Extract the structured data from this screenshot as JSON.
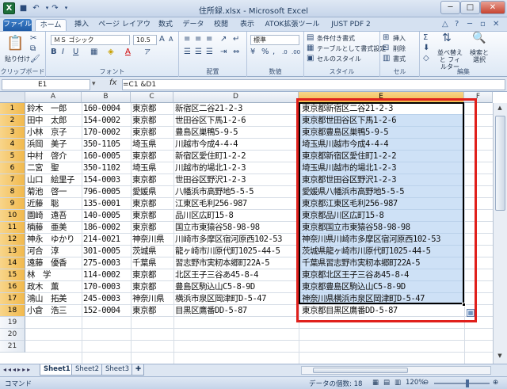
{
  "window": {
    "title": "住所録.xlsx - Microsoft Excel",
    "app_icon_label": "X"
  },
  "ribbon_tabs": [
    "ファイル",
    "ホーム",
    "挿入",
    "ページ レイアウト",
    "数式",
    "データ",
    "校閲",
    "表示",
    "ATOK拡張ツール",
    "JUST PDF 2"
  ],
  "ribbon": {
    "clipboard": {
      "group_label": "クリップボード",
      "paste_label": "貼り付け"
    },
    "font": {
      "group_label": "フォント",
      "font_name": "ＭＳ ゴシック",
      "font_size": "10.5"
    },
    "alignment": {
      "group_label": "配置"
    },
    "number": {
      "group_label": "数値",
      "format": "標準"
    },
    "styles": {
      "group_label": "スタイル",
      "conditional": "条件付き書式",
      "table": "テーブルとして書式設定",
      "cell_style": "セルのスタイル"
    },
    "cells": {
      "group_label": "セル",
      "insert": "挿入",
      "delete": "削除",
      "format": "書式"
    },
    "editing": {
      "group_label": "編集",
      "sort": "並べ替えと フィルター",
      "find": "検索と 選択"
    }
  },
  "formula_bar": {
    "name_box": "E1",
    "fx": "fx",
    "formula": "=C1 &D1"
  },
  "columns": [
    "A",
    "B",
    "C",
    "D",
    "E",
    "F"
  ],
  "rows": [
    {
      "n": "1",
      "a": "鈴木　一郎",
      "b": "160-0004",
      "c": "東京都",
      "d": "新宿区二谷21-2-3",
      "e": "東京都新宿区二谷21-2-3"
    },
    {
      "n": "2",
      "a": "田中　太郎",
      "b": "154-0002",
      "c": "東京都",
      "d": "世田谷区下馬1-2-6",
      "e": "東京都世田谷区下馬1-2-6"
    },
    {
      "n": "3",
      "a": "小林　京子",
      "b": "170-0002",
      "c": "東京都",
      "d": "豊島区巣鴨5-9-5",
      "e": "東京都豊島区巣鴨5-9-5"
    },
    {
      "n": "4",
      "a": "浜岡　美子",
      "b": "350-1105",
      "c": "埼玉県",
      "d": "川越市今成4-4-4",
      "e": "埼玉県川越市今成4-4-4"
    },
    {
      "n": "5",
      "a": "中村　啓介",
      "b": "160-0005",
      "c": "東京都",
      "d": "新宿区愛住町1-2-2",
      "e": "東京都新宿区愛住町1-2-2"
    },
    {
      "n": "6",
      "a": "二宮　聖",
      "b": "350-1102",
      "c": "埼玉県",
      "d": "川越市的場北1-2-3",
      "e": "埼玉県川越市的場北1-2-3"
    },
    {
      "n": "7",
      "a": "山口　絵里子",
      "b": "154-0003",
      "c": "東京都",
      "d": "世田谷区野沢1-2-3",
      "e": "東京都世田谷区野沢1-2-3"
    },
    {
      "n": "8",
      "a": "菊池　啓一",
      "b": "796-0005",
      "c": "愛媛県",
      "d": "八幡浜市高野地5-5-5",
      "e": "愛媛県八幡浜市高野地5-5-5"
    },
    {
      "n": "9",
      "a": "近藤　聡",
      "b": "135-0001",
      "c": "東京都",
      "d": "江東区毛利256-987",
      "e": "東京都江東区毛利256-987"
    },
    {
      "n": "10",
      "a": "園崎　遠吾",
      "b": "140-0005",
      "c": "東京都",
      "d": "品川区広町15-8",
      "e": "東京都品川区広町15-8"
    },
    {
      "n": "11",
      "a": "楠藤　亜美",
      "b": "186-0002",
      "c": "東京都",
      "d": "国立市東猿谷58-98-98",
      "e": "東京都国立市東猿谷58-98-98"
    },
    {
      "n": "12",
      "a": "神永　ゆかり",
      "b": "214-0021",
      "c": "神奈川県",
      "d": "川崎市多摩区宿河原西102-53",
      "e": "神奈川県川崎市多摩区宿河原西102-53"
    },
    {
      "n": "13",
      "a": "河合　淳",
      "b": "301-0005",
      "c": "茨城県",
      "d": "龍ヶ崎市川原代町1025-44-5",
      "e": "茨城県龍ヶ崎市川原代町1025-44-5"
    },
    {
      "n": "14",
      "a": "遠藤　優香",
      "b": "275-0003",
      "c": "千葉県",
      "d": "習志野市実籾本郷町22A-5",
      "e": "千葉県習志野市実籾本郷町22A-5"
    },
    {
      "n": "15",
      "a": "林　学",
      "b": "114-0002",
      "c": "東京都",
      "d": "北区王子三谷あ45-8-4",
      "e": "東京都北区王子三谷あ45-8-4"
    },
    {
      "n": "16",
      "a": "政木　薫",
      "b": "170-0003",
      "c": "東京都",
      "d": "豊島区駒込山C5-8-9D",
      "e": "東京都豊島区駒込山C5-8-9D"
    },
    {
      "n": "17",
      "a": "鴻山　拓美",
      "b": "245-0003",
      "c": "神奈川県",
      "d": "横浜市泉区岡津町D-5-47",
      "e": "神奈川県横浜市泉区岡津町D-5-47"
    },
    {
      "n": "18",
      "a": "小倉　浩三",
      "b": "152-0004",
      "c": "東京都",
      "d": "目黒区鷹番DD-5-87",
      "e": "東京都目黒区鷹番DD-5-87"
    },
    {
      "n": "19",
      "a": "",
      "b": "",
      "c": "",
      "d": "",
      "e": ""
    },
    {
      "n": "20",
      "a": "",
      "b": "",
      "c": "",
      "d": "",
      "e": ""
    },
    {
      "n": "21",
      "a": "",
      "b": "",
      "c": "",
      "d": "",
      "e": ""
    }
  ],
  "sheets": [
    "Sheet1",
    "Sheet2",
    "Sheet3"
  ],
  "status": {
    "mode": "コマンド",
    "count": "データの個数: 18",
    "zoom": "120%"
  }
}
